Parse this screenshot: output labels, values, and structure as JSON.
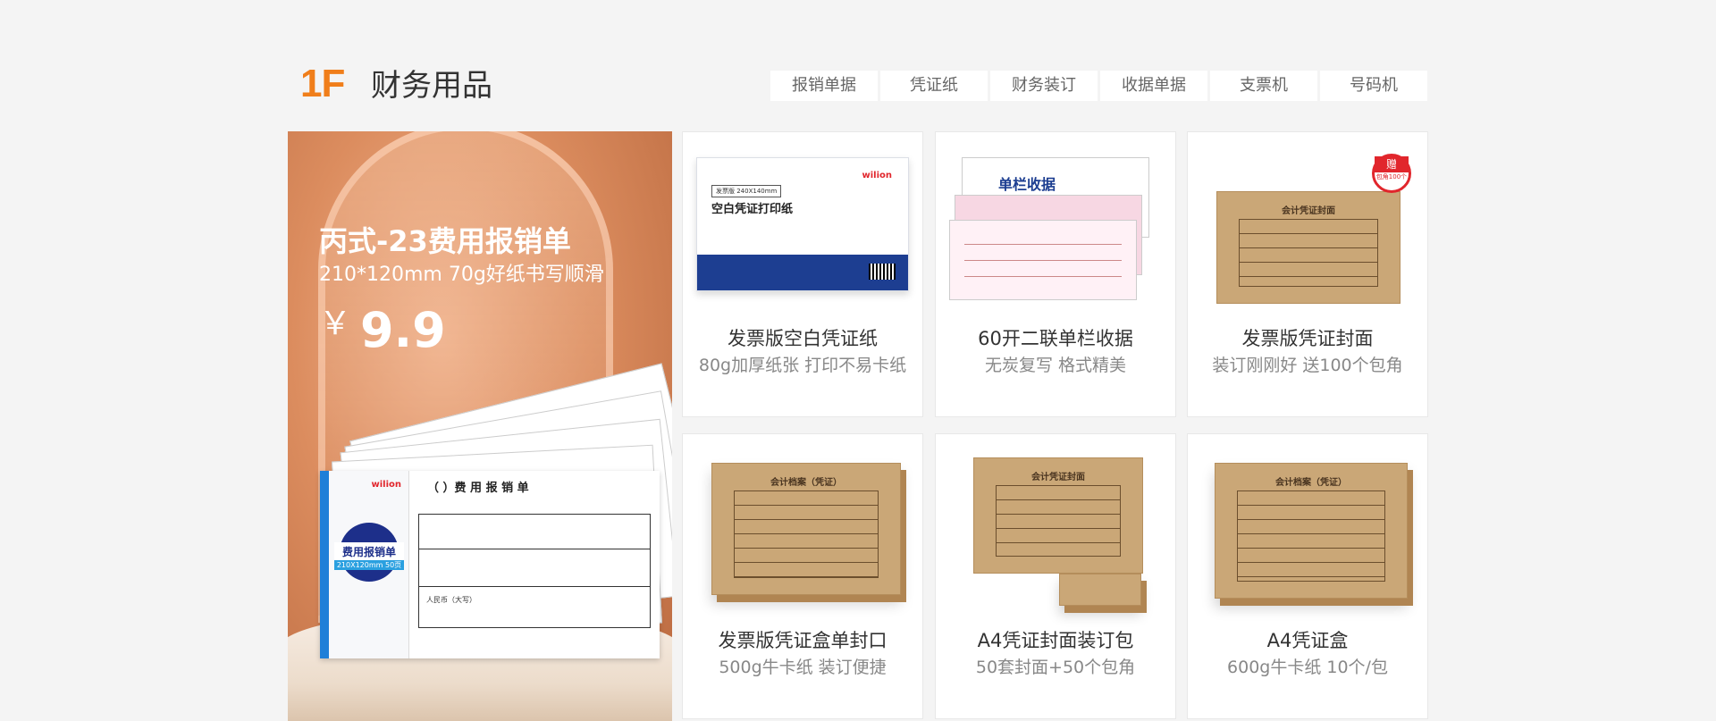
{
  "floor": {
    "number": "1F",
    "title": "财务用品",
    "tabs": [
      "报销单据",
      "凭证纸",
      "财务装订",
      "收据单据",
      "支票机",
      "号码机"
    ]
  },
  "banner": {
    "title": "丙式-23费用报销单",
    "subtitle": "210*120mm 70g好纸书写顺滑",
    "currency": "￥",
    "price": "9.9",
    "form": {
      "brand": "wilion",
      "cover_label": "费用报销单",
      "cover_size": "210X120mm  50页",
      "heading": "（        ）费 用 报 销 单",
      "amount_label": "人民币（大写）"
    }
  },
  "products": [
    {
      "name": "发票版空白凭证纸",
      "desc": "80g加厚纸张 打印不易卡纸",
      "illustration": "white-voucher-paper",
      "art": {
        "tag": "发票版 240X140mm",
        "title": "空白凭证打印纸",
        "logo": "wilion"
      }
    },
    {
      "name": "60开二联单栏收据",
      "desc": "无炭复写   格式精美",
      "illustration": "receipt-book",
      "art": {
        "title": "单栏收据"
      }
    },
    {
      "name": "发票版凭证封面",
      "desc": "装订刚刚好  送100个包角",
      "illustration": "voucher-cover",
      "art": {
        "title": "会计凭证封面",
        "gift": "赠",
        "gift_note": "包角100个"
      }
    },
    {
      "name": "发票版凭证盒单封口",
      "desc": "500g牛卡纸  装订便捷",
      "illustration": "voucher-box",
      "art": {
        "title": "会计档案（凭证）"
      }
    },
    {
      "name": "A4凭证封面装订包",
      "desc": "50套封面+50个包角",
      "illustration": "a4-cover-pack",
      "art": {
        "title": "会计凭证封面"
      }
    },
    {
      "name": "A4凭证盒",
      "desc": "600g牛卡纸  10个/包",
      "illustration": "a4-voucher-box",
      "art": {
        "title": "会计档案（凭证）"
      }
    }
  ],
  "colors": {
    "accent": "#f07e1a",
    "background": "#f4f4f4",
    "kraft": "#caa777"
  }
}
